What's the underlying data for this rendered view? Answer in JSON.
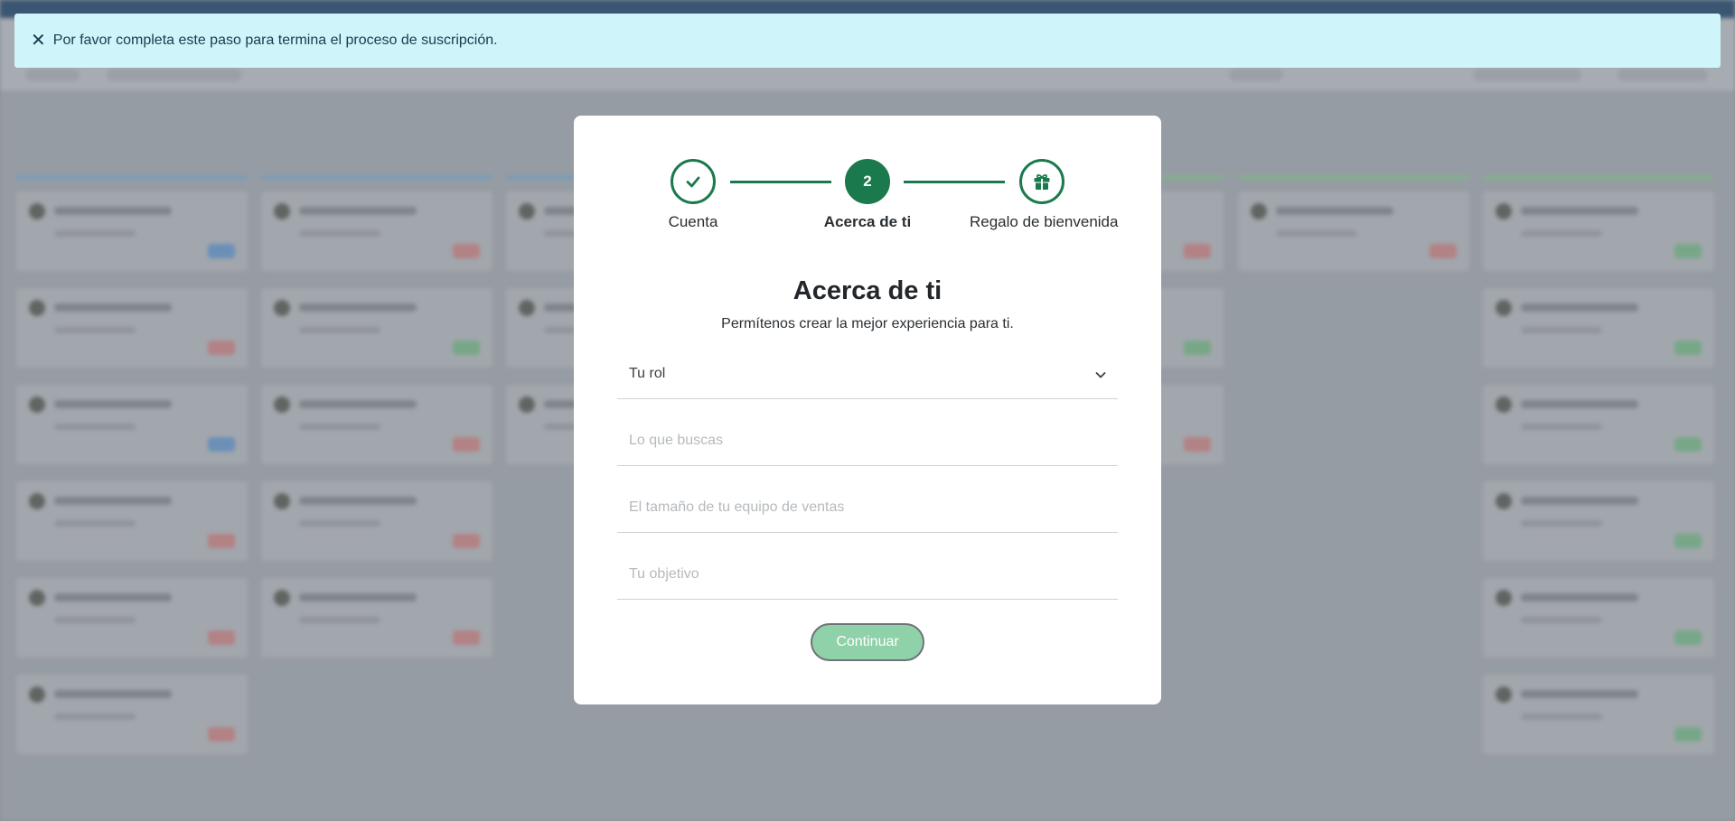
{
  "banner": {
    "close_icon": "close-icon",
    "message": "Por favor completa este paso para termina el proceso de suscripción."
  },
  "modal": {
    "steps": [
      {
        "label": "Cuenta",
        "state": "completed",
        "icon": "check-icon"
      },
      {
        "label": "Acerca de ti",
        "state": "active",
        "number": "2"
      },
      {
        "label": "Regalo de bienvenida",
        "state": "pending",
        "icon": "gift-icon"
      }
    ],
    "title": "Acerca de ti",
    "subtitle": "Permítenos crear la mejor experiencia para ti.",
    "fields": {
      "role": {
        "value": "Tu rol",
        "icon": "chevron-down-icon"
      },
      "looking_for": {
        "placeholder": "Lo que buscas"
      },
      "team_size": {
        "placeholder": "El tamaño de tu equipo de ventas"
      },
      "goal": {
        "placeholder": "Tu objetivo"
      }
    },
    "continue_label": "Continuar"
  },
  "colors": {
    "accent": "#1b7a4d",
    "button": "#8fd1a8",
    "banner": "#cff5fb"
  }
}
